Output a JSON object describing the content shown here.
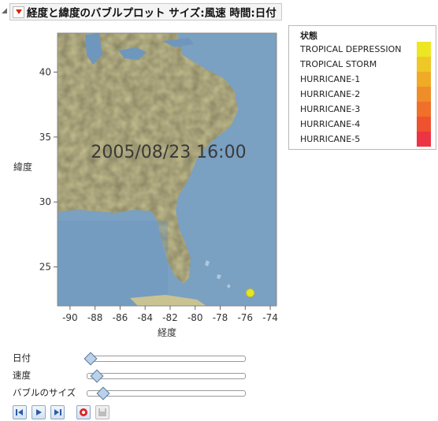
{
  "title": "経度と緯度のバブルプロット サイズ:風速  時間:日付",
  "time_label": "2005/08/23 16:00",
  "x_axis": {
    "title": "経度",
    "ticks": [
      "-90",
      "-88",
      "-86",
      "-84",
      "-82",
      "-80",
      "-78",
      "-76",
      "-74"
    ],
    "tick_values": [
      -90,
      -88,
      -86,
      -84,
      -82,
      -80,
      -78,
      -76,
      -74
    ],
    "range": [
      -91,
      -73.5
    ]
  },
  "y_axis": {
    "title": "緯度",
    "ticks": [
      "25",
      "30",
      "35",
      "40"
    ],
    "tick_values": [
      25,
      30,
      35,
      40
    ],
    "range": [
      22,
      43
    ]
  },
  "bubble": {
    "longitude": -75.6,
    "latitude": 23.0,
    "status": "TROPICAL DEPRESSION",
    "color": "#e6e626"
  },
  "legend": {
    "title": "状態",
    "items": [
      {
        "label": "TROPICAL DEPRESSION",
        "color": "#ede623"
      },
      {
        "label": "TROPICAL STORM",
        "color": "#efc726"
      },
      {
        "label": "HURRICANE-1",
        "color": "#efaa26"
      },
      {
        "label": "HURRICANE-2",
        "color": "#ef8d28"
      },
      {
        "label": "HURRICANE-3",
        "color": "#ef6f2b"
      },
      {
        "label": "HURRICANE-4",
        "color": "#ef522f"
      },
      {
        "label": "HURRICANE-5",
        "color": "#ec3443"
      }
    ]
  },
  "controls": {
    "date_label": "日付",
    "speed_label": "速度",
    "bubble_size_label": "バブルのサイズ",
    "date_position": 0.0,
    "speed_position": 0.04,
    "bubble_size_position": 0.08
  },
  "toolbar": {
    "step_back": "step-back-icon",
    "play": "play-icon",
    "step_forward": "step-forward-icon",
    "record": "record-icon",
    "save": "save-icon"
  }
}
